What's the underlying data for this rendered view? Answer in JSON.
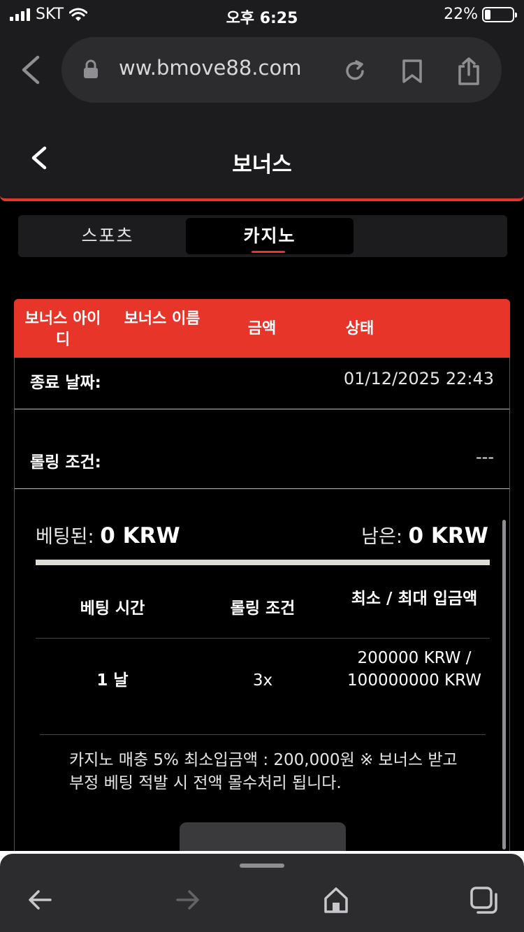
{
  "status_bar": {
    "carrier": "SKT",
    "time": "오후 6:25",
    "battery_text": "22%",
    "battery_level": 0.22
  },
  "browser": {
    "url": "ww.bmove88.com"
  },
  "header": {
    "title": "보너스"
  },
  "tabs": [
    {
      "label": "스포츠",
      "active": false
    },
    {
      "label": "카지노",
      "active": true
    }
  ],
  "table": {
    "headers": [
      "보너스 아이디",
      "보너스 이름",
      "금액",
      "상태"
    ]
  },
  "details": {
    "end_date_label": "종료 날짜:",
    "end_date_value": "01/12/2025 22:43",
    "rolling_label": "롤링 조건:",
    "rolling_value": "---"
  },
  "betting": {
    "bet_label": "베팅된:",
    "bet_value": "0 KRW",
    "remaining_label": "남은:",
    "remaining_value": "0 KRW",
    "progress_fraction": 0
  },
  "conditions": {
    "headers": [
      "베팅 시간",
      "롤링 조건",
      "최소 / 최대 입금액"
    ],
    "row": [
      "1 날",
      "3x",
      "200000 KRW / 100000000 KRW"
    ]
  },
  "notice": "카지노 매충 5% 최소입금액 : 200,000원 ※ 보너스 받고 부정 베팅 적발 시 전액 몰수처리 됩니다.",
  "colors": {
    "accent": "#e8352a",
    "panel": "#1c1c1e",
    "background": "#000000"
  },
  "icons": [
    "back-chevron-icon",
    "lock-icon",
    "reload-icon",
    "bookmark-icon",
    "share-icon",
    "arrow-left-icon",
    "arrow-right-icon",
    "home-icon",
    "tabs-icon"
  ]
}
